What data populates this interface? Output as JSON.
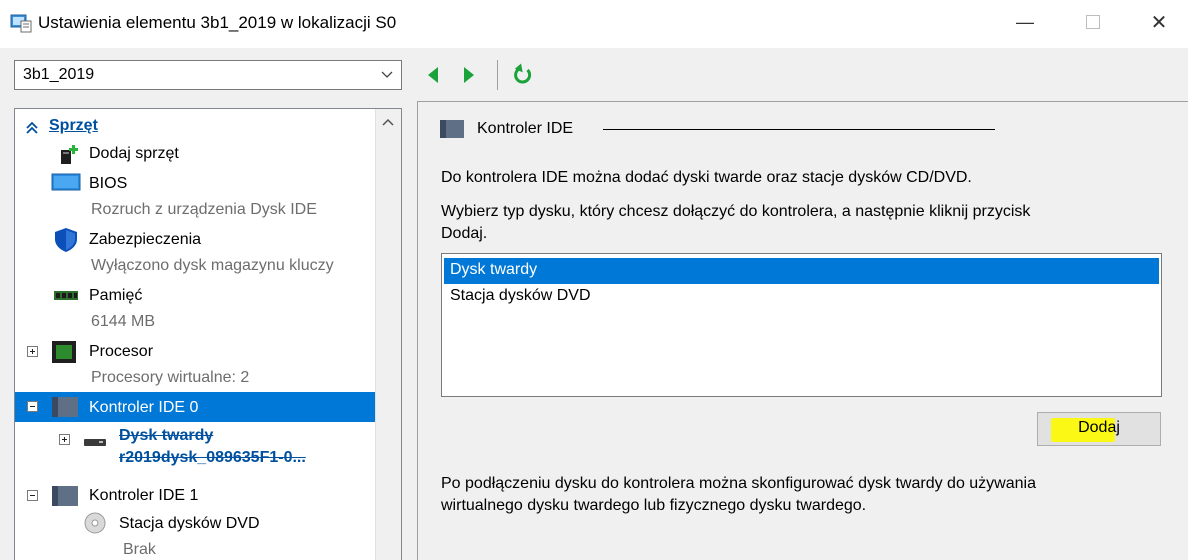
{
  "window": {
    "title": "Ustawienia elementu 3b1_2019 w lokalizacji S0",
    "minimize_symbol": "—",
    "close_symbol": "✕"
  },
  "toolbar": {
    "vm_selected": "3b1_2019"
  },
  "tree": {
    "section_header": "Sprzęt",
    "items": [
      {
        "label": "Dodaj sprzęt"
      },
      {
        "label": "BIOS",
        "sub": "Rozruch z urządzenia Dysk IDE"
      },
      {
        "label": "Zabezpieczenia",
        "sub": "Wyłączono dysk magazynu kluczy"
      },
      {
        "label": "Pamięć",
        "sub": "6144 MB"
      },
      {
        "label": "Procesor",
        "sub": "Procesory wirtualne: 2"
      },
      {
        "label": "Kontroler IDE 0"
      },
      {
        "label": "Dysk twardy",
        "sub": "r2019dysk_089635F1-0..."
      },
      {
        "label": "Kontroler IDE 1"
      },
      {
        "label": "Stacja dysków DVD",
        "sub": "Brak"
      }
    ]
  },
  "panel": {
    "group_title": "Kontroler IDE",
    "description": "Do kontrolera IDE można dodać dyski twarde oraz stacje dysków CD/DVD.",
    "instruction_line1": "Wybierz typ dysku, który chcesz dołączyć do kontrolera, a następnie kliknij przycisk",
    "instruction_line2": "Dodaj.",
    "disk_types": [
      "Dysk twardy",
      "Stacja dysków DVD"
    ],
    "add_button": "Dodaj",
    "footer_line1": "Po podłączeniu dysku do kontrolera można skonfigurować dysk twardy do używania",
    "footer_line2": "wirtualnego dysku twardego lub fizycznego dysku twardego."
  },
  "colors": {
    "selection": "#0078d7",
    "highlight": "#fffb00",
    "nav_green": "#1aa33a"
  }
}
